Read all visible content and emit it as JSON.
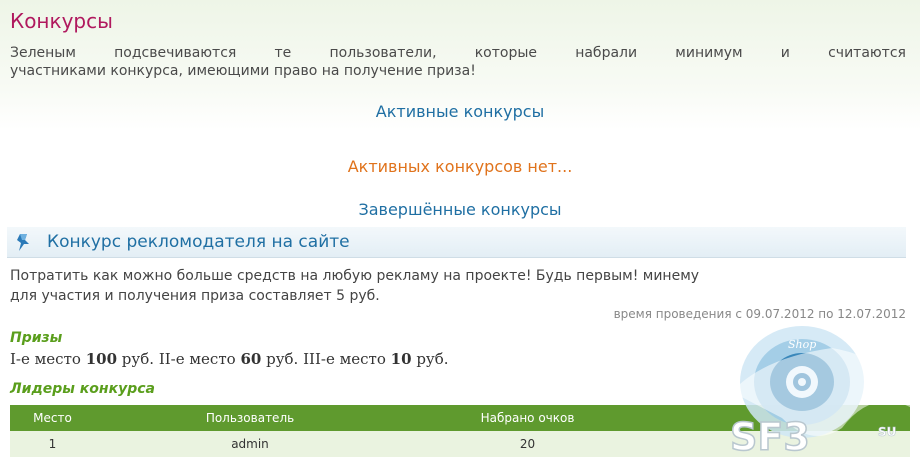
{
  "page": {
    "title": "Конкурсы",
    "intro_line1_words": [
      "Зеленым",
      "подсвечиваются",
      "те",
      "пользователи,",
      "которые",
      "набрали",
      "минимум",
      "и",
      "считаются"
    ],
    "intro_line2": "участниками конкурса, имеющими право на получение приза!"
  },
  "active": {
    "link_label": "Активные конкурсы",
    "empty_message": "Активных конкурсов нет..."
  },
  "finished": {
    "link_label": "Завершённые конкурсы"
  },
  "contest": {
    "title": "Конкурс рекломодателя на сайте",
    "icon": "pin-icon",
    "description_line1": "Потратить как можно больше средств на любую рекламу на проекте! Будь первым! минему",
    "description_line2": "для участия и получения приза составляет 5 руб.",
    "dates": "время проведения с 09.07.2012 по 12.07.2012",
    "prizes_heading": "Призы",
    "prizes": [
      {
        "place": "I-е место",
        "amount": "100",
        "unit": "руб."
      },
      {
        "place": "II-е место",
        "amount": "60",
        "unit": "руб."
      },
      {
        "place": "III-е место",
        "amount": "10",
        "unit": "руб."
      }
    ],
    "leaders_heading": "Лидеры конкурса",
    "table": {
      "headers": [
        "Место",
        "Пользователь",
        "Набрано очков",
        ""
      ],
      "rows": [
        [
          "1",
          "admin",
          "20",
          ""
        ]
      ]
    }
  },
  "watermark": {
    "text_shop": "Shop",
    "text_brand": "SF3",
    "text_tld": "SU"
  },
  "colors": {
    "title": "#b0195e",
    "link": "#1f6fa3",
    "empty": "#e0731c",
    "green_heading": "#5a9e1c",
    "table_header": "#5f9a2e",
    "table_row": "#eaf3e0"
  }
}
